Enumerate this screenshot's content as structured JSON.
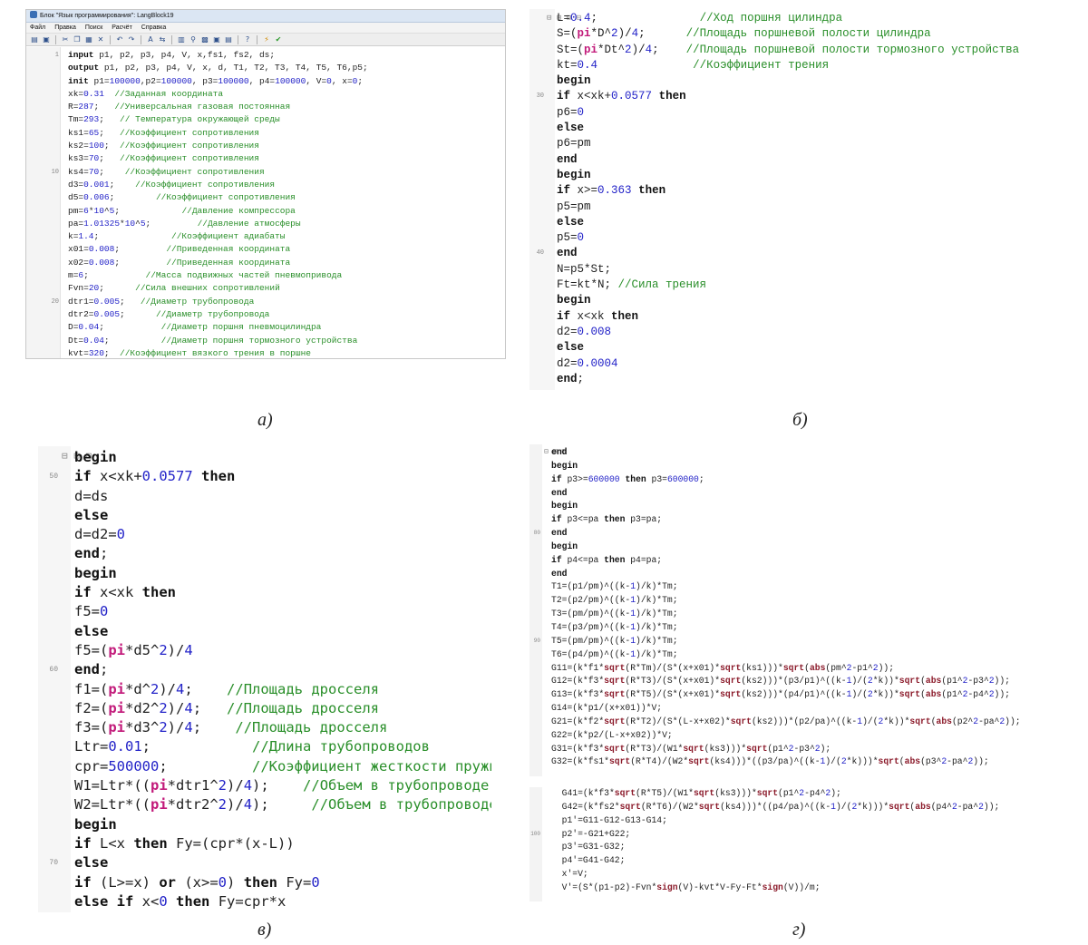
{
  "panel_a": {
    "title": "Блок \"Язык программирования\": LangBlock19",
    "menu": [
      "Файл",
      "Правка",
      "Поиск",
      "Расчёт",
      "Справка"
    ],
    "toolbar_icons": [
      "open-icon",
      "save-icon",
      "cut-icon",
      "copy-icon",
      "paste-icon",
      "delete-icon",
      "undo-icon",
      "redo-icon",
      "find-icon",
      "replace-icon",
      "calc-icon",
      "run-icon",
      "check-icon",
      "help-icon"
    ],
    "line_numbers": [
      "1",
      "",
      "",
      "",
      "",
      "",
      "",
      "",
      "",
      "10",
      "",
      "",
      "",
      "",
      "",
      "",
      "",
      "",
      "",
      "20"
    ],
    "caption": "а)"
  },
  "panel_b": {
    "line_numbers": [
      "",
      "",
      "",
      "",
      "",
      "30",
      "",
      "",
      "",
      "",
      "",
      "",
      "",
      "",
      "",
      "40"
    ],
    "caption": "б)"
  },
  "panel_c": {
    "line_numbers": [
      "",
      "50",
      "",
      "",
      "",
      "",
      "",
      "",
      "",
      "",
      "",
      "60"
    ],
    "caption": "в)"
  },
  "panel_d": {
    "caption": "г)"
  }
}
